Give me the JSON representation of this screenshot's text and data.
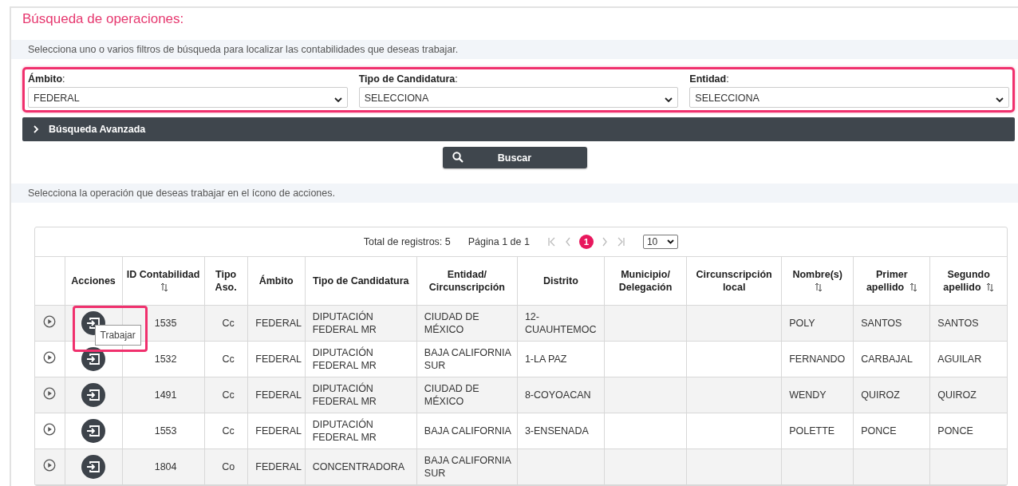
{
  "title": "Búsqueda de operaciones:",
  "filter_instructions": "Selecciona uno o varios filtros de búsqueda para localizar las contabilidades que deseas trabajar.",
  "filters_panel": {
    "highlight": true,
    "filters": [
      {
        "label": "**Ámbito**:",
        "value": "FEDERAL"
      },
      {
        "label": "**Tipo de Candidatura**:",
        "value": "SELECCIONA"
      },
      {
        "label": "**Entidad**:",
        "value": "SELECCIONA"
      }
    ]
  },
  "advanced_search": {
    "label": "Búsqueda Avanzada",
    "expanded": false
  },
  "search_button": "Buscar",
  "table_instructions": "Selecciona la operación que deseas trabajar en el ícono de acciones.",
  "pagination": {
    "total": "Total de registros: 5",
    "page": "Página 1 de 1",
    "pages": [
      {
        "label": "1",
        "selected": true
      }
    ],
    "page_size": "10"
  },
  "table": {
    "columns": [
      {
        "label": "Acciones",
        "sortable": false
      },
      {
        "label": "ID Contabilidad",
        "sortable": true
      },
      {
        "label": "Tipo Aso.",
        "sortable": false
      },
      {
        "label": "Ámbito",
        "sortable": false
      },
      {
        "label": "Tipo de Candidatura",
        "sortable": false
      },
      {
        "label": "Entidad/ Circunscripción",
        "sortable": false
      },
      {
        "label": "Distrito",
        "sortable": false
      },
      {
        "label": "Municipio/ Delegación",
        "sortable": false
      },
      {
        "label": "Circunscripción local",
        "sortable": false
      },
      {
        "label": "Nombre(s)",
        "sortable": true
      },
      {
        "label": "Primer apellido",
        "sortable": true
      },
      {
        "label": "Segundo apellido",
        "sortable": true
      }
    ],
    "rows": [
      {
        "action_highlight": true,
        "tooltip": "Trabajar",
        "id": "1535",
        "tipo_aso": "Cc",
        "ambito": "FEDERAL",
        "tipo_candidatura": "DIPUTACIÓN FEDERAL MR",
        "entidad": "CIUDAD DE MÉXICO",
        "distrito": "12-CUAUHTEMOC",
        "nombre": "POLY",
        "primer_apellido": "SANTOS",
        "segundo_apellido": "SANTOS"
      },
      {
        "action_highlight": false,
        "id": "1532",
        "tipo_aso": "Cc",
        "ambito": "FEDERAL",
        "tipo_candidatura": "DIPUTACIÓN FEDERAL MR",
        "entidad": "BAJA CALIFORNIA SUR",
        "distrito": "1-LA PAZ",
        "nombre": "FERNANDO",
        "primer_apellido": "CARBAJAL",
        "segundo_apellido": "AGUILAR"
      },
      {
        "action_highlight": false,
        "id": "1491",
        "tipo_aso": "Cc",
        "ambito": "FEDERAL",
        "tipo_candidatura": "DIPUTACIÓN FEDERAL MR",
        "entidad": "CIUDAD DE MÉXICO",
        "distrito": "8-COYOACAN",
        "nombre": "WENDY",
        "primer_apellido": "QUIROZ",
        "segundo_apellido": "QUIROZ"
      },
      {
        "action_highlight": false,
        "id": "1553",
        "tipo_aso": "Cc",
        "ambito": "FEDERAL",
        "tipo_candidatura": "DIPUTACIÓN FEDERAL MR",
        "entidad": "BAJA CALIFORNIA",
        "distrito": "3-ENSENADA",
        "nombre": "POLETTE",
        "primer_apellido": "PONCE",
        "segundo_apellido": "PONCE"
      },
      {
        "action_highlight": false,
        "id": "1804",
        "tipo_aso": "Co",
        "ambito": "FEDERAL",
        "tipo_candidatura": "CONCENTRADORA",
        "entidad": "BAJA CALIFORNIA SUR"
      }
    ]
  }
}
